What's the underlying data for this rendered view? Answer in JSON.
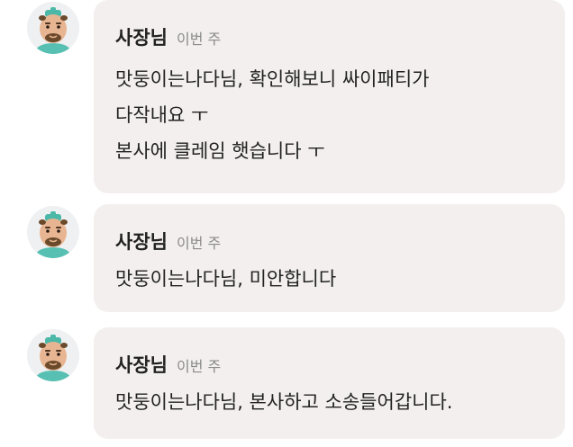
{
  "messages": [
    {
      "sender": "사장님",
      "time": "이번 주",
      "lines": [
        "맛둥이는나다님, 확인해보니 싸이패티가",
        "다작내요 ㅜ",
        "본사에 클레임 햇습니다 ㅜ"
      ]
    },
    {
      "sender": "사장님",
      "time": "이번 주",
      "lines": [
        "맛둥이는나다님, 미안합니다"
      ]
    },
    {
      "sender": "사장님",
      "time": "이번 주",
      "lines": [
        "맛둥이는나다님, 본사하고 소송들어갑니다."
      ]
    }
  ],
  "colors": {
    "bubble_bg": "#f3efee",
    "avatar_bg": "#eef0f1",
    "timestamp": "#8a8a8a",
    "text": "#222222"
  },
  "icons": {
    "avatar": "owner-character-avatar-icon"
  }
}
